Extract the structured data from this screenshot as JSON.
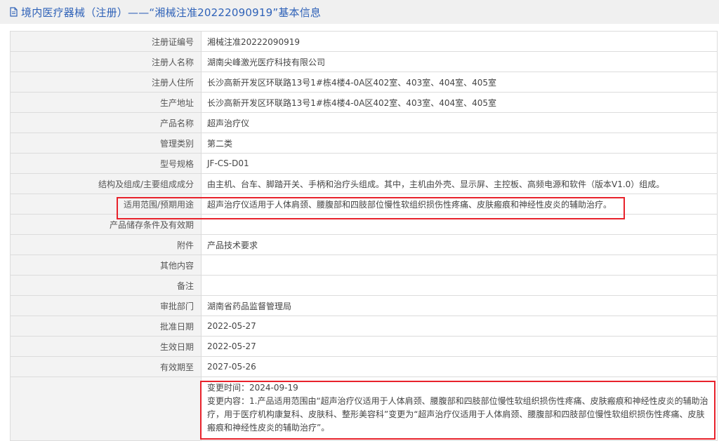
{
  "header": {
    "title": "境内医疗器械（注册）——“湘械注准20222090919”基本信息"
  },
  "rows": [
    {
      "label": "注册证编号",
      "value": "湘械注准20222090919"
    },
    {
      "label": "注册人名称",
      "value": "湖南尖峰激光医疗科技有限公司"
    },
    {
      "label": "注册人住所",
      "value": "长沙高新开发区环联路13号1#栋4楼4-0A区402室、403室、404室、405室"
    },
    {
      "label": "生产地址",
      "value": "长沙高新开发区环联路13号1#栋4楼4-0A区402室、403室、404室、405室"
    },
    {
      "label": "产品名称",
      "value": "超声治疗仪"
    },
    {
      "label": "管理类别",
      "value": "第二类"
    },
    {
      "label": "型号规格",
      "value": "JF-CS-D01"
    },
    {
      "label": "结构及组成/主要组成成分",
      "value": "由主机、台车、脚踏开关、手柄和治疗头组成。其中，主机由外壳、显示屏、主控板、高频电源和软件（版本V1.0）组成。"
    },
    {
      "label": "适用范围/预期用途",
      "value": "超声治疗仪适用于人体肩颈、腰腹部和四肢部位慢性软组织损伤性疼痛、皮肤瘢痕和神经性皮炎的辅助治疗。"
    },
    {
      "label": "产品储存条件及有效期",
      "value": ""
    },
    {
      "label": "附件",
      "value": "产品技术要求"
    },
    {
      "label": "其他内容",
      "value": ""
    },
    {
      "label": "备注",
      "value": ""
    },
    {
      "label": "审批部门",
      "value": "湖南省药品监督管理局"
    },
    {
      "label": "批准日期",
      "value": "2022-05-27"
    },
    {
      "label": "生效日期",
      "value": "2022-05-27"
    },
    {
      "label": "有效期至",
      "value": "2027-05-26"
    }
  ],
  "change": {
    "time_line": "变更时间：2024-09-19",
    "content_line": "变更内容：1.产品适用范围由“超声治疗仪适用于人体肩颈、腰腹部和四肢部位慢性软组织损伤性疼痛、皮肤瘢痕和神经性皮炎的辅助治疗，用于医疗机构康复科、皮肤科、整形美容科”变更为“超声治疗仪适用于人体肩颈、腰腹部和四肢部位慢性软组织损伤性疼痛、皮肤瘢痕和神经性皮炎的辅助治疗”。"
  },
  "colors": {
    "header_text": "#2f62b8",
    "highlight_border": "#e8222b",
    "label_bg": "#f3f3f3"
  }
}
